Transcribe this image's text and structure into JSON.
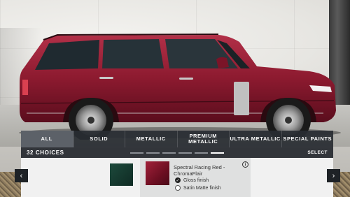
{
  "colors": {
    "accent_panel": "#2c3036",
    "selected_paint": "#8c1a2f",
    "green_paint": "#1d4a3c"
  },
  "paint_tabs": [
    {
      "label": "ALL",
      "active": true
    },
    {
      "label": "SOLID",
      "active": false
    },
    {
      "label": "METALLIC",
      "active": false
    },
    {
      "label": "PREMIUM METALLIC",
      "active": false
    },
    {
      "label": "ULTRA METALLIC",
      "active": false
    },
    {
      "label": "SPECIAL PAINTS",
      "active": false
    }
  ],
  "choices_label": "32 CHOICES",
  "select_label": "SELECT",
  "pager": {
    "count": 6,
    "active_index": 5
  },
  "selected_paint": {
    "name": "Spectral Racing Red - ChromaFlair",
    "info_icon": "info-icon",
    "options": [
      {
        "label": "Gloss finish",
        "selected": true
      },
      {
        "label": "Satin Matte finish",
        "selected": false
      }
    ]
  },
  "nav": {
    "prev_icon": "chevron-left-icon",
    "prev_glyph": "‹",
    "next_icon": "chevron-right-icon",
    "next_glyph": "›"
  }
}
